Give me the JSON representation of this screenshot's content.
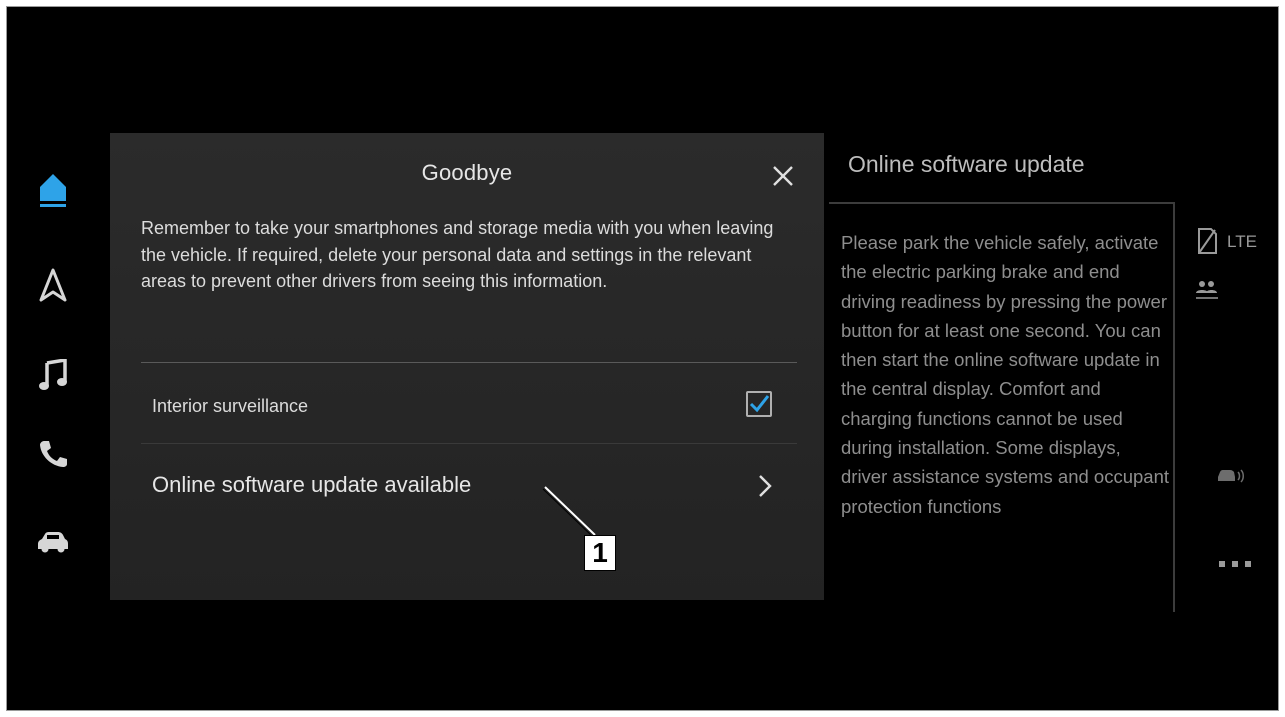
{
  "nav": {
    "items": [
      {
        "icon": "home-icon",
        "active": true
      },
      {
        "icon": "navigation-arrow-icon",
        "active": false
      },
      {
        "icon": "music-note-icon",
        "active": false
      },
      {
        "icon": "phone-icon",
        "active": false
      },
      {
        "icon": "car-icon",
        "active": false
      }
    ]
  },
  "dialog": {
    "title": "Goodbye",
    "close_icon": "close-icon",
    "body": "Remember to take your smartphones and storage media with you when leaving the vehicle. If required, delete your personal data and settings in the relevant areas to prevent other drivers from seeing this information.",
    "surveillance": {
      "label": "Interior surveillance",
      "checked": true
    },
    "update_row": {
      "label": "Online software update available",
      "icon": "chevron-right-icon"
    }
  },
  "callout": {
    "number": "1"
  },
  "side_panel": {
    "title": "Online software update",
    "text": "Please park the vehicle safely, activate the electric parking brake and end driving readiness by pressing the power button for at least one second. You can then start the online software update in the central display. Comfort and charging functions cannot be used during installation. Some displays, driver assistance systems and occupant protection functions"
  },
  "status_bar": {
    "network": "LTE",
    "icons": [
      "no-sim-icon",
      "persons-icon",
      "car-signal-icon",
      "more-icon"
    ]
  },
  "colors": {
    "accent": "#2ea3e8",
    "background": "#000000",
    "dialog": "#272727"
  }
}
